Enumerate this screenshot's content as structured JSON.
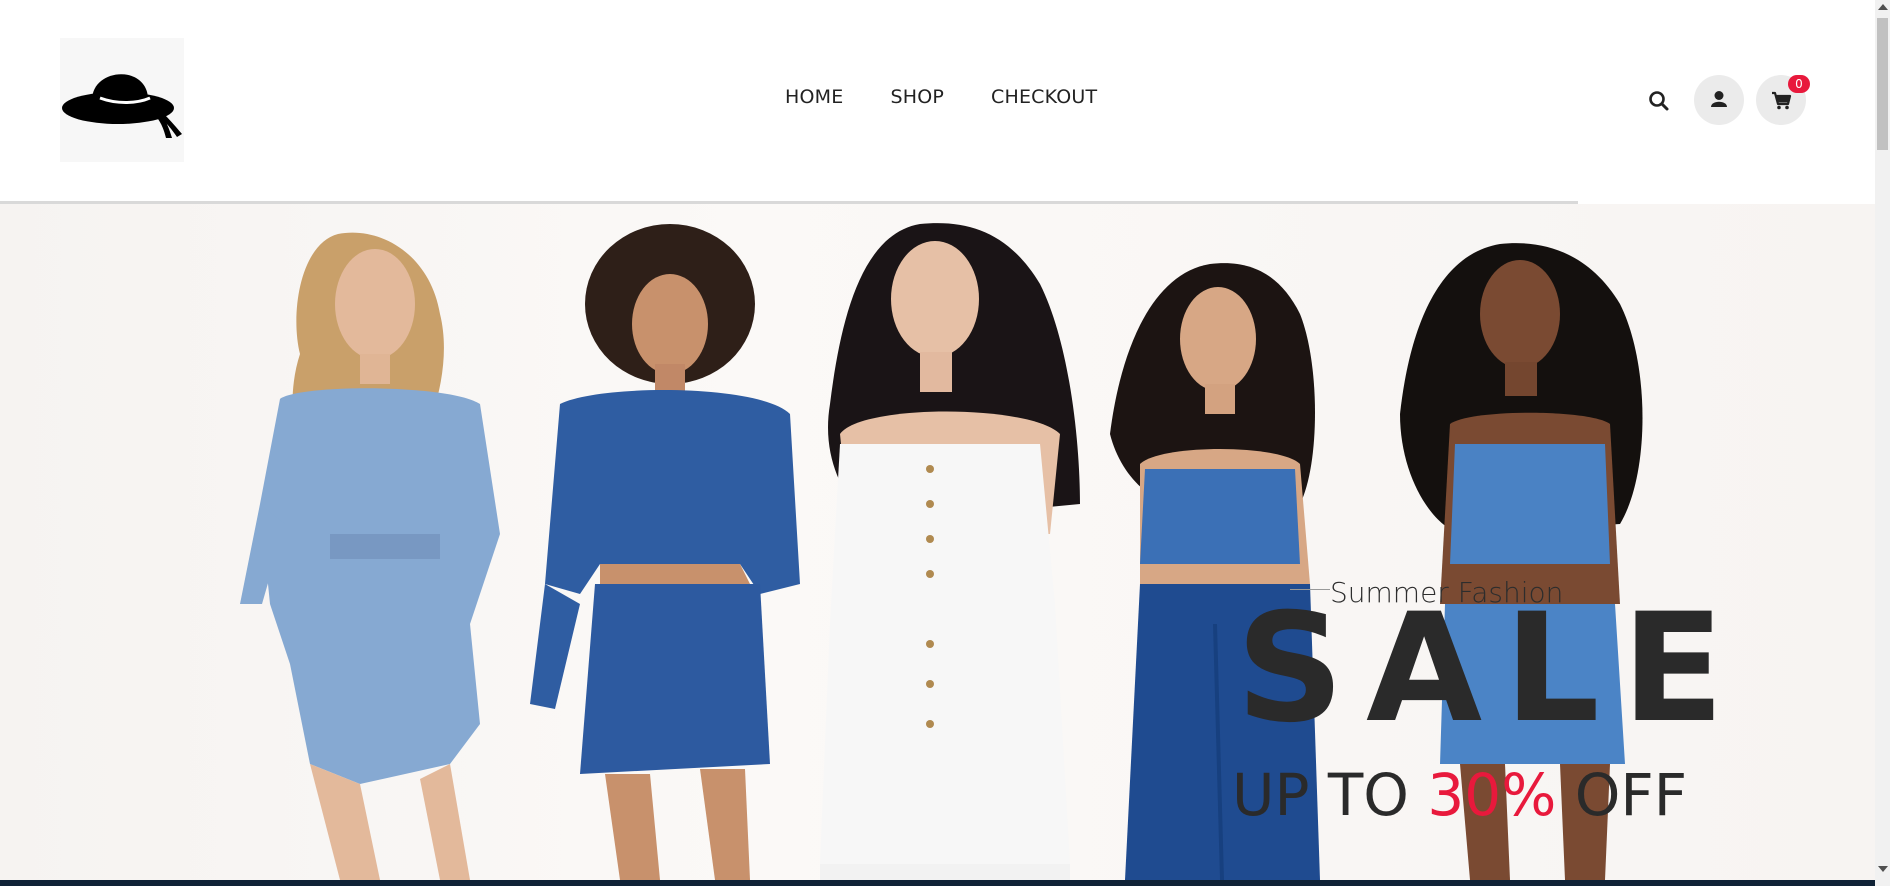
{
  "nav": {
    "items": [
      {
        "label": "HOME"
      },
      {
        "label": "SHOP"
      },
      {
        "label": "CHECKOUT"
      }
    ]
  },
  "header_icons": {
    "search": "search-icon",
    "account": "user-icon",
    "cart": "cart-icon",
    "cart_count": "0"
  },
  "hero": {
    "subtitle": "Summer Fashion",
    "title": "SALE",
    "offer_prefix": "UP TO ",
    "offer_percent": "30%",
    "offer_suffix": " OFF"
  },
  "colors": {
    "accent": "#e8193c",
    "text": "#2a2a2a",
    "footer_bar": "#0f2236"
  }
}
